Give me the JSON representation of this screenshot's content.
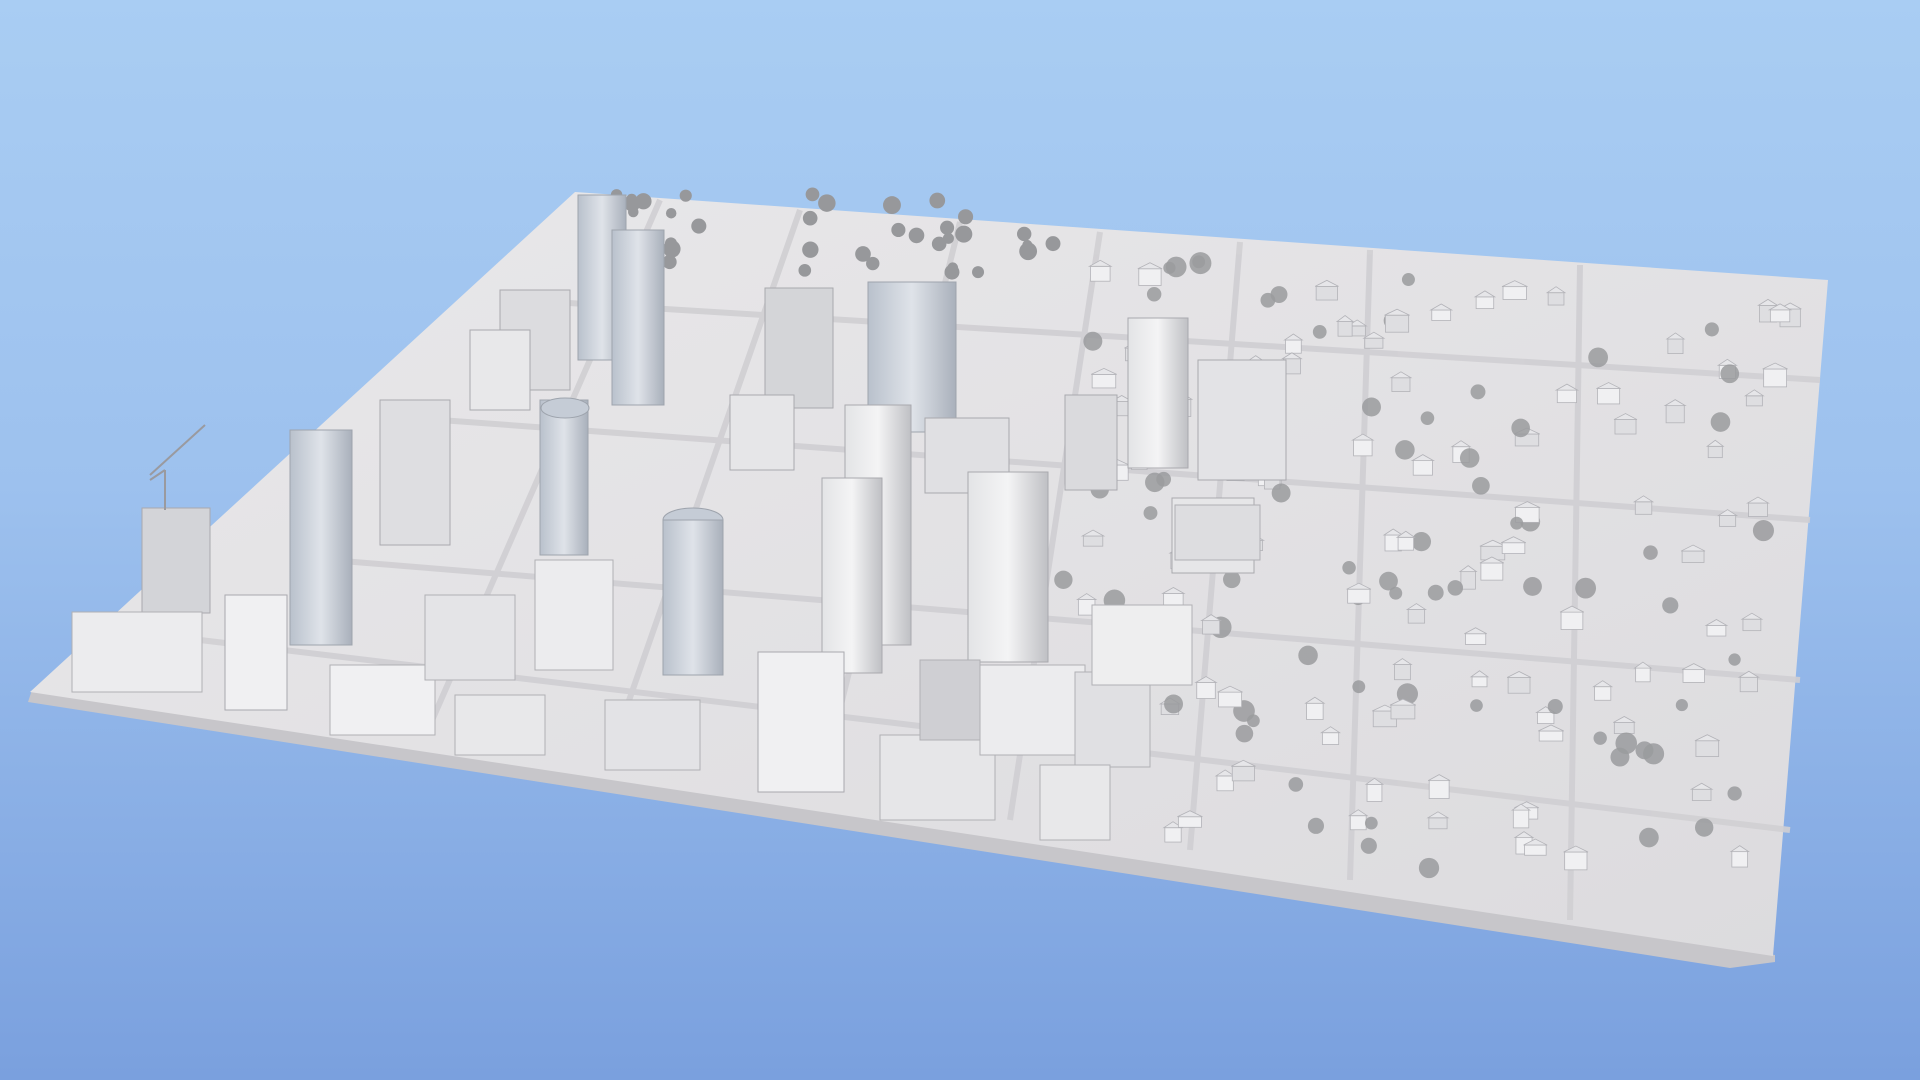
{
  "scene": {
    "subject": "city",
    "colors": {
      "sky_top": "#a9cdf3",
      "sky_mid": "#9fc3ee",
      "sky_bottom": "#7ea4e0",
      "ground": "#e7e6e8",
      "ground_edge": "#c9c9cc",
      "road": "#d6d5d8",
      "building_light": "#f2f2f3",
      "building_mid": "#d9d9dc",
      "building_dark": "#b8b8bd",
      "glass": "#c3cad4",
      "tree": "#8f9093",
      "shadow": "#a8a8ad"
    }
  }
}
